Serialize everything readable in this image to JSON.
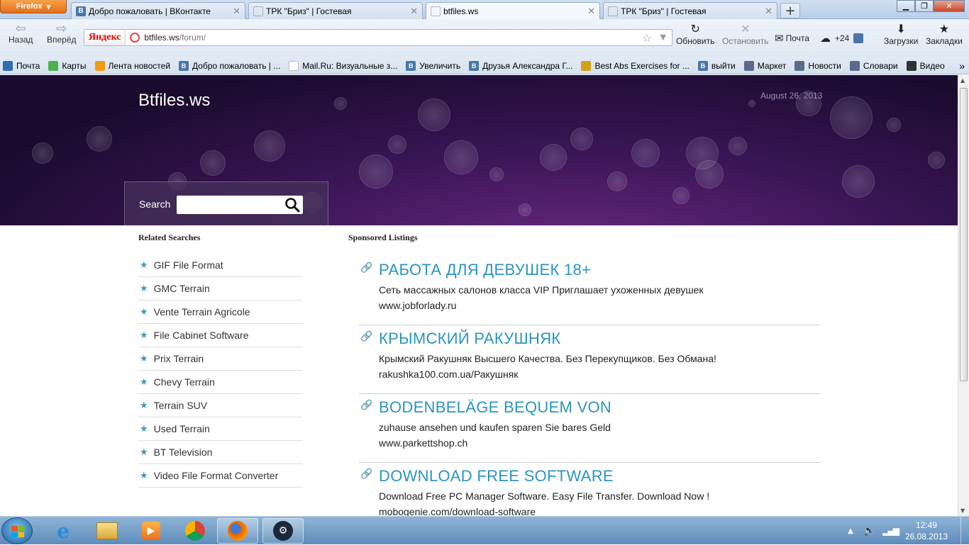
{
  "browser": {
    "app_button": "Firefox",
    "tabs": [
      {
        "title": "Добро пожаловать | ВКонтакте",
        "icon": "vk-icon"
      },
      {
        "title": "ТРК \"Бриз\" | Гостевая",
        "icon": "blank-page-icon"
      },
      {
        "title": "btfiles.ws",
        "icon": "blank-page-icon",
        "active": true
      },
      {
        "title": "ТРК \"Бриз\" | Гостевая",
        "icon": "blank-page-icon"
      }
    ],
    "nav": {
      "back": "Назад",
      "forward": "Вперёд"
    },
    "yandex_label": "Яндекс",
    "url_domain": "btfiles.ws",
    "url_path": "/forum/",
    "tools": {
      "reload": "Обновить",
      "stop": "Остановить",
      "mail": "Почта",
      "weather": "+24",
      "downloads": "Загрузки",
      "bookmarks": "Закладки"
    },
    "bookmarks_bar": [
      {
        "label": "Почта",
        "icon": "mail-icon",
        "color": "#2f6fb5"
      },
      {
        "label": "Карты",
        "icon": "maps-icon",
        "color": "#4caf50"
      },
      {
        "label": "Лента новостей",
        "icon": "rss-icon",
        "color": "#f39c12"
      },
      {
        "label": "Добро пожаловать | ...",
        "icon": "vk-icon",
        "color": "#4a76a8"
      },
      {
        "label": "Mail.Ru: Визуальные з...",
        "icon": "blank-page-icon",
        "color": "#ffffff"
      },
      {
        "label": "Увеличить",
        "icon": "vk-icon",
        "color": "#4a76a8"
      },
      {
        "label": "Друзья Александра Г...",
        "icon": "vk-icon",
        "color": "#4a76a8"
      },
      {
        "label": "Best Abs Exercises for ...",
        "icon": "heart-icon",
        "color": "#d4a017"
      },
      {
        "label": "выйти",
        "icon": "vk-icon",
        "color": "#4a76a8"
      },
      {
        "label": "Маркет",
        "icon": "market-icon",
        "color": "#5a6b8c"
      },
      {
        "label": "Новости",
        "icon": "news-icon",
        "color": "#5a6b8c"
      },
      {
        "label": "Словари",
        "icon": "dictionary-icon",
        "color": "#5a6b8c"
      },
      {
        "label": "Видео",
        "icon": "video-icon",
        "color": "#333333"
      }
    ],
    "bookmarks_overflow": "»"
  },
  "page": {
    "site_title": "Btfiles.ws",
    "date": "August 26, 2013",
    "search_label": "Search",
    "search_value": "",
    "related_heading": "Related Searches",
    "sponsored_heading": "Sponsored Listings",
    "related": [
      "GIF File Format",
      "GMC Terrain",
      "Vente Terrain Agricole",
      "File Cabinet Software",
      "Prix Terrain",
      "Chevy Terrain",
      "Terrain SUV",
      "Used Terrain",
      "BT Television",
      "Video File Format Converter"
    ],
    "ads": [
      {
        "title": "РАБОТА ДЛЯ ДЕВУШЕК 18+",
        "desc": "Сеть массажных салонов класса VIP Приглашает ухоженных девушек",
        "url": "www.jobforlady.ru"
      },
      {
        "title": "КРЫМСКИЙ РАКУШНЯК",
        "desc": "Крымский Ракушняк Высшего Качества. Без Перекупщиков. Без Обмана!",
        "url": "rakushka100.com.ua/Ракушняк"
      },
      {
        "title": "BODENBELÄGE BEQUEM VON",
        "desc": "zuhause ansehen und kaufen sparen Sie bares Geld",
        "url": "www.parkettshop.ch"
      },
      {
        "title": "DOWNLOAD FREE SOFTWARE",
        "desc": "Download Free PC Manager Software. Easy File Transfer. Download Now !",
        "url": "mobogenie.com/download-software"
      }
    ],
    "colors": {
      "ad_title": "#2a95bf",
      "star": "#3c99b8",
      "hero": "#3b1657"
    }
  },
  "taskbar": {
    "apps": [
      "internet-explorer-icon",
      "file-explorer-icon",
      "media-player-icon",
      "chrome-icon",
      "firefox-icon",
      "steam-icon"
    ],
    "time": "12:49",
    "date": "26.08.2013"
  }
}
